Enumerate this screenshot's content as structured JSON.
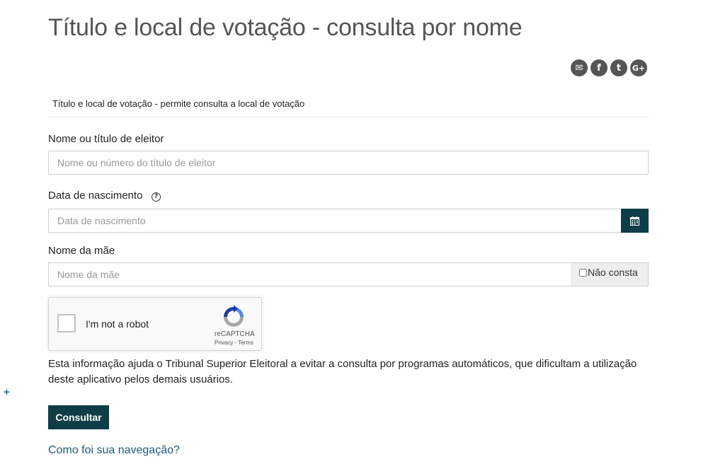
{
  "page": {
    "title": "Título e local de votação - consulta por nome",
    "subtitle": "Título e local de votação - permite consulta a local de votação"
  },
  "share": {
    "items": [
      {
        "icon": "email-icon",
        "glyph": "✉"
      },
      {
        "icon": "facebook-icon",
        "glyph": "f"
      },
      {
        "icon": "twitter-icon",
        "glyph": "t"
      },
      {
        "icon": "google-plus-icon",
        "glyph": "G+"
      }
    ]
  },
  "form": {
    "name_label": "Nome ou título de eleitor",
    "name_placeholder": "Nome ou número do título de eleitor",
    "name_value": "",
    "birth_label": "Data de nascimento",
    "birth_help_icon": "question-circle-icon",
    "birth_help_glyph": "?",
    "birth_placeholder": "Data de nascimento",
    "birth_value": "",
    "calendar_icon": "calendar-icon",
    "mother_label": "Nome da mãe",
    "mother_placeholder": "Nome da mãe",
    "mother_value": "",
    "nao_consta_label": "Não consta",
    "nao_consta_checked": false
  },
  "recaptcha": {
    "label": "I'm not a robot",
    "name": "reCAPTCHA",
    "links": "Privacy - Terms",
    "logo_icon": "recaptcha-logo-icon",
    "checked": false
  },
  "info_text": "Esta informação ajuda o Tribunal Superior Eleitoral a evitar a consulta por programas automáticos, que dificultam a utilização deste aplicativo pelos demais usuários.",
  "plus_glyph": "+",
  "submit_label": "Consultar",
  "feedback_link": "Como foi sua navegação?",
  "colors": {
    "primary": "#0e3d47",
    "link": "#1f5a7a",
    "title": "#555555",
    "icon_circle": "#555555"
  }
}
